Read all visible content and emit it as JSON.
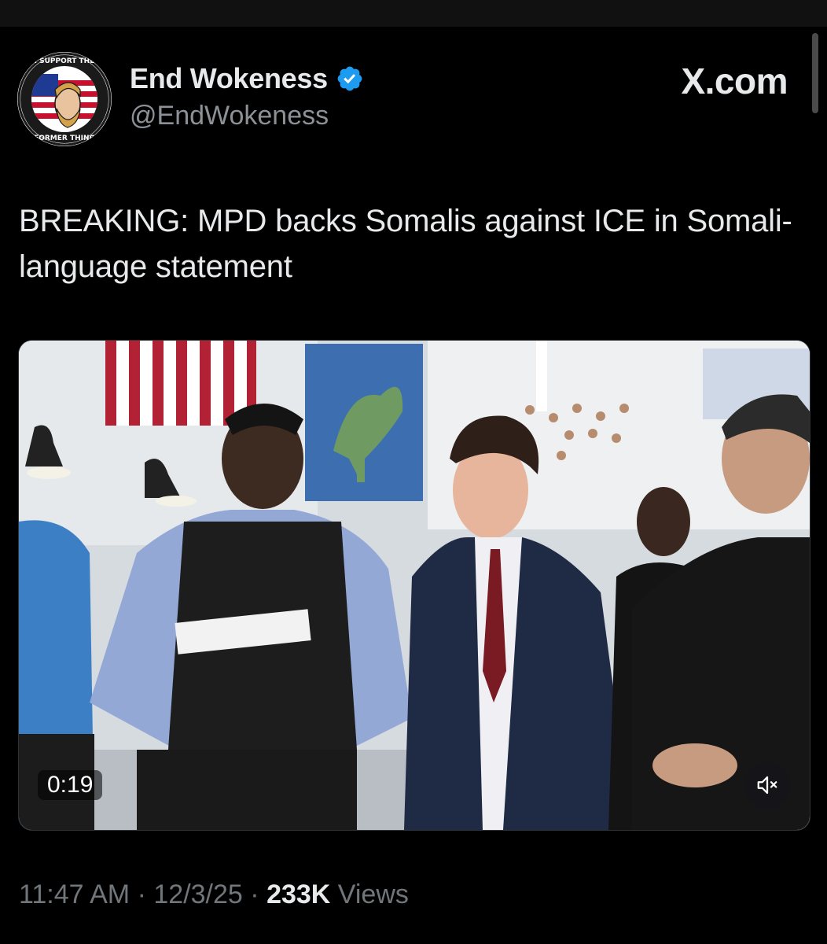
{
  "author": {
    "display_name": "End Wokeness",
    "handle": "@EndWokeness",
    "verified": true,
    "avatar_text_top": "I SUPPORT THE",
    "avatar_text_bottom": "FORMER THING"
  },
  "brand": {
    "label": "X.com"
  },
  "tweet": {
    "text": "BREAKING: MPD backs Somalis against ICE in Somali-language statement"
  },
  "video": {
    "duration": "0:19",
    "muted": true
  },
  "meta": {
    "time": "11:47 AM",
    "separator": "·",
    "date": "12/3/25",
    "views_count": "233K",
    "views_label": "Views"
  },
  "colors": {
    "background": "#000000",
    "text_primary": "#e7e9ea",
    "text_secondary": "#71767b",
    "verified_blue": "#1d9bf0"
  },
  "icons": {
    "verified": "verified-badge-icon",
    "mute": "speaker-muted-icon"
  }
}
